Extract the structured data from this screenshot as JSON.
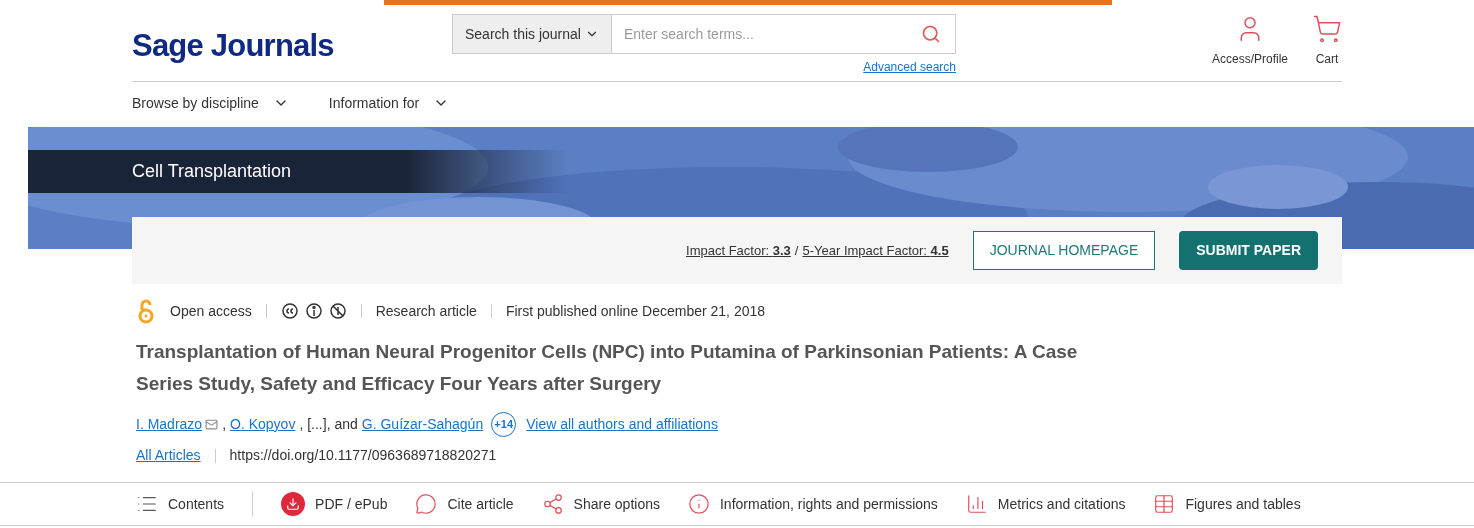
{
  "header": {
    "logo": "Sage Journals",
    "search_scope": "Search this journal",
    "search_placeholder": "Enter search terms...",
    "advanced_search": "Advanced search",
    "actions": [
      {
        "kind": "profile",
        "label": "Access/Profile"
      },
      {
        "kind": "cart",
        "label": "Cart"
      }
    ]
  },
  "nav": [
    "Browse by discipline",
    "Information for"
  ],
  "journal": {
    "title": "Cell Transplantation",
    "impact": [
      "Impact Factor: **3.3** ",
      "5-Year Impact Factor: **4.5**"
    ],
    "separator": "/",
    "homepage_button": "JOURNAL HOMEPAGE",
    "submit_button": "SUBMIT PAPER"
  },
  "article": {
    "access": "Open access",
    "type": "Research article",
    "published": "First published online December 21, 2018",
    "title": "Transplantation of Human Neural Progenitor Cells (NPC) into Putamina of Parkinsonian Patients: A Case Series Study, Safety and Efficacy Four Years after Surgery",
    "authors": [
      {
        "kind": "link",
        "text": "I. Madrazo",
        "email": true
      },
      {
        "kind": "text",
        "text": ","
      },
      {
        "kind": "link",
        "text": "O. Kopyov",
        "email": false
      },
      {
        "kind": "text",
        "text": ", [...], and"
      },
      {
        "kind": "link",
        "text": "G. Guízar-Sahagún",
        "email": false
      }
    ],
    "more_authors": "+14",
    "all_authors": "View all authors and affiliations",
    "section": "All Articles",
    "doi": "https://doi.org/10.1177/0963689718820271"
  },
  "toolbar": [
    {
      "kind": "contents",
      "label": "Contents"
    },
    {
      "kind": "pdf",
      "label": "PDF / ePub"
    },
    {
      "kind": "cite",
      "label": "Cite article"
    },
    {
      "kind": "share",
      "label": "Share options"
    },
    {
      "kind": "info",
      "label": "Information, rights and permissions"
    },
    {
      "kind": "metrics",
      "label": "Metrics and citations"
    },
    {
      "kind": "figures",
      "label": "Figures and tables"
    }
  ]
}
